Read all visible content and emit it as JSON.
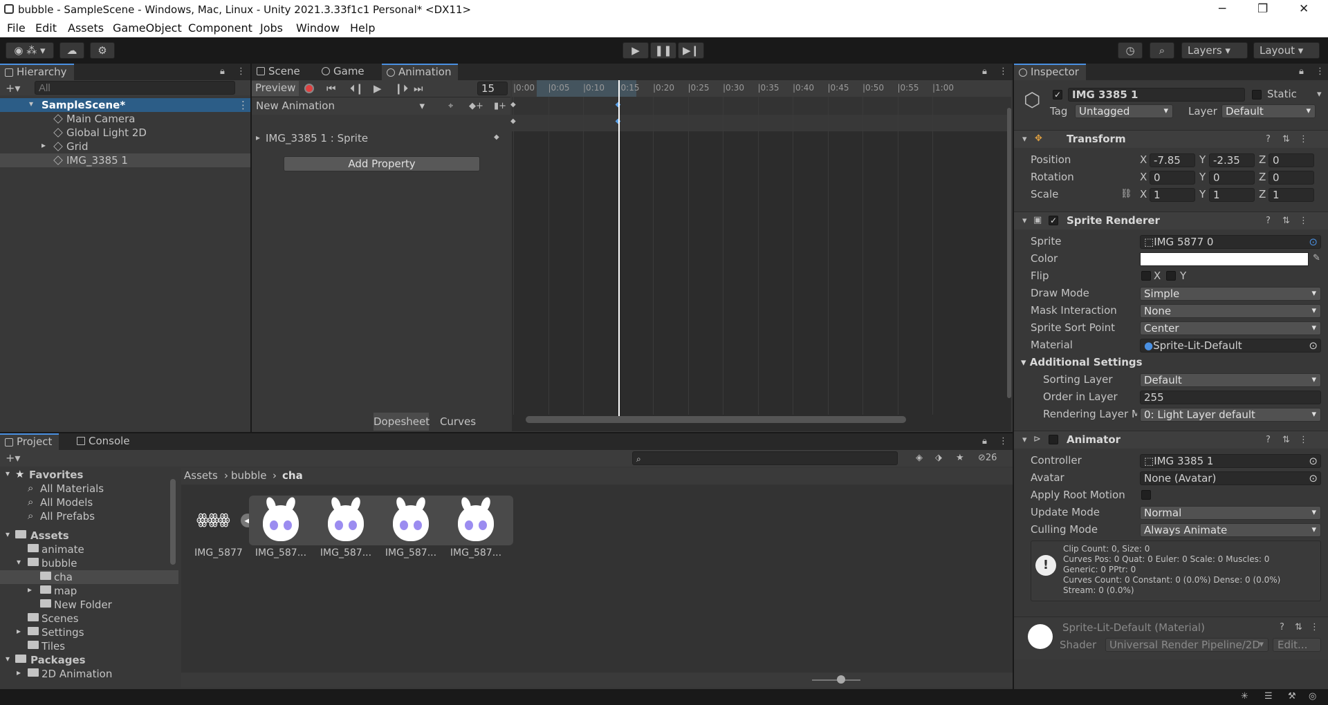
{
  "window": {
    "title": "bubble - SampleScene - Windows, Mac, Linux - Unity 2021.3.33f1c1 Personal* <DX11>",
    "minimize": "─",
    "maximize": "❐",
    "close": "✕"
  },
  "menu": [
    "File",
    "Edit",
    "Assets",
    "GameObject",
    "Component",
    "Jobs",
    "Window",
    "Help"
  ],
  "toolbar": {
    "layers": "Layers",
    "layout": "Layout"
  },
  "hierarchy": {
    "tab": "Hierarchy",
    "search_placeholder": "All",
    "scene": "SampleScene*",
    "items": [
      "Main Camera",
      "Global Light 2D",
      "Grid",
      "IMG_3385 1"
    ]
  },
  "center_tabs": [
    "Scene",
    "Game",
    "Animation"
  ],
  "animation": {
    "preview": "Preview",
    "frame": "15",
    "clip": "New Animation",
    "property": "IMG_3385 1 : Sprite",
    "add_property": "Add Property",
    "dopesheet": "Dopesheet",
    "curves": "Curves",
    "timeline_ticks": [
      "0:00",
      "0:05",
      "0:10",
      "0:15",
      "0:20",
      "0:25",
      "0:30",
      "0:35",
      "0:40",
      "0:45",
      "0:50",
      "0:55",
      "1:00"
    ],
    "current_time": "0:15",
    "keyframe_times": [
      "0:00",
      "0:15"
    ]
  },
  "project": {
    "tabs": [
      "Project",
      "Console"
    ],
    "count": "26",
    "favorites": "Favorites",
    "fav_items": [
      "All Materials",
      "All Models",
      "All Prefabs"
    ],
    "assets": "Assets",
    "tree": [
      "animate",
      "bubble",
      "cha",
      "map",
      "New Folder",
      "Scenes",
      "Settings",
      "Tiles"
    ],
    "packages": "Packages",
    "pkg_items": [
      "2D Animation"
    ],
    "breadcrumb": [
      "Assets",
      "bubble",
      "cha"
    ],
    "sprites": [
      "IMG_5877",
      "IMG_587...",
      "IMG_587...",
      "IMG_587...",
      "IMG_587..."
    ]
  },
  "inspector": {
    "tab": "Inspector",
    "name": "IMG 3385 1",
    "static": "Static",
    "tag_label": "Tag",
    "tag": "Untagged",
    "layer_label": "Layer",
    "layer": "Default",
    "transform": {
      "title": "Transform",
      "position_label": "Position",
      "rotation_label": "Rotation",
      "scale_label": "Scale",
      "position": [
        "-7.85",
        "-2.35",
        "0"
      ],
      "rotation": [
        "0",
        "0",
        "0"
      ],
      "scale": [
        "1",
        "1",
        "1"
      ],
      "axes": [
        "X",
        "Y",
        "Z"
      ]
    },
    "sprite_renderer": {
      "title": "Sprite Renderer",
      "sprite_label": "Sprite",
      "sprite": "IMG 5877 0",
      "color_label": "Color",
      "flip_label": "Flip",
      "flip_x": "X",
      "flip_y": "Y",
      "draw_mode_label": "Draw Mode",
      "draw_mode": "Simple",
      "mask_label": "Mask Interaction",
      "mask": "None",
      "sort_point_label": "Sprite Sort Point",
      "sort_point": "Center",
      "material_label": "Material",
      "material": "Sprite-Lit-Default",
      "additional": "Additional Settings",
      "sorting_layer_label": "Sorting Layer",
      "sorting_layer": "Default",
      "order_label": "Order in Layer",
      "order": "255",
      "rendering_layer_label": "Rendering Layer M",
      "rendering_layer": "0: Light Layer default"
    },
    "animator": {
      "title": "Animator",
      "controller_label": "Controller",
      "controller": "IMG 3385 1",
      "avatar_label": "Avatar",
      "avatar": "None (Avatar)",
      "root_motion_label": "Apply Root Motion",
      "update_label": "Update Mode",
      "update": "Normal",
      "culling_label": "Culling Mode",
      "culling": "Always Animate",
      "info": [
        "Clip Count: 0, Size: 0",
        "Curves Pos: 0 Quat: 0 Euler: 0 Scale: 0 Muscles: 0",
        "Generic: 0 PPtr: 0",
        "Curves Count: 0 Constant: 0 (0.0%) Dense: 0 (0.0%)",
        "Stream: 0 (0.0%)"
      ]
    },
    "material": {
      "title": "Sprite-Lit-Default (Material)",
      "shader_label": "Shader",
      "shader": "Universal Render Pipeline/2D",
      "edit": "Edit..."
    }
  }
}
